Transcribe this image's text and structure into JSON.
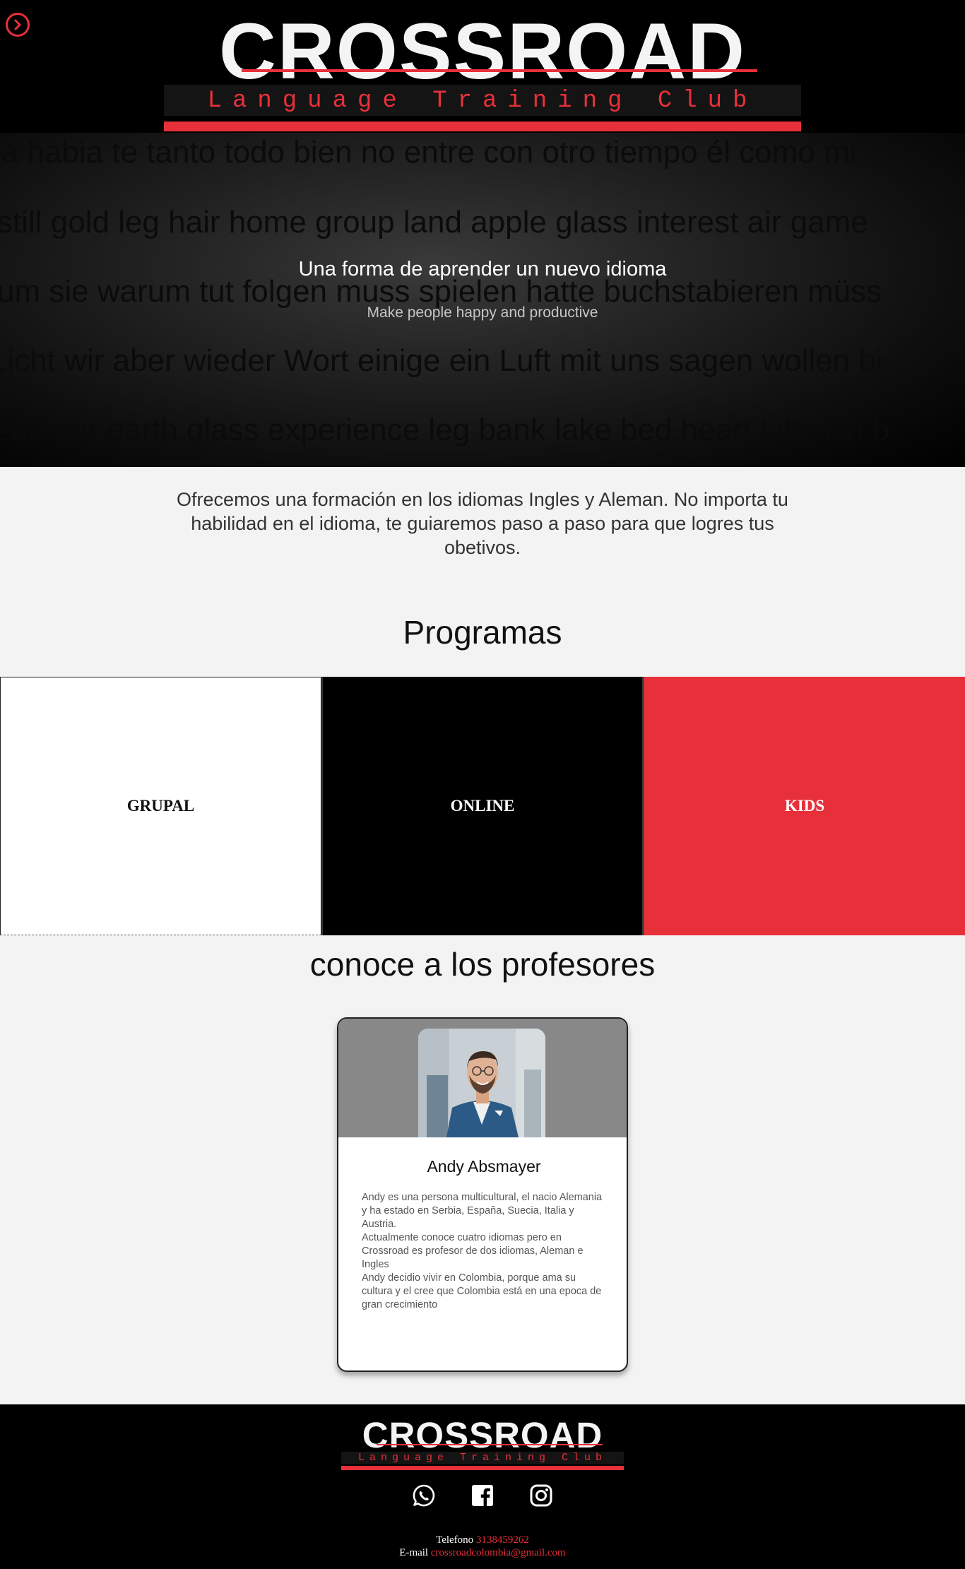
{
  "header": {
    "logo_word": "CROSSROAD",
    "logo_sub": "Language Training Club",
    "menu_icon": "chevron-right-circle-icon",
    "accent_color": "#e8303a"
  },
  "hero": {
    "background_lines": [
      "la habia te tanto todo bien no entre con otro tiempo él como mi",
      "still gold leg hair home group land apple glass interest air game",
      "um sie warum tut folgen muss spielen hatte buchstabieren müss",
      "Licht wir aber wieder Wort einige ein Luft mit uns sagen wollen bi",
      "ed hour earth glass experience leg bank lake bed heart bill inch b"
    ],
    "title": "Una forma de aprender un nuevo idioma",
    "subtitle": "Make people happy and productive"
  },
  "intro": {
    "text": "Ofrecemos una formación en los idiomas Ingles y Aleman. No importa tu habilidad en el idioma, te guiaremos paso a paso para que logres tus obetivos."
  },
  "programs": {
    "title": "Programas",
    "items": [
      {
        "label": "GRUPAL"
      },
      {
        "label": "ONLINE"
      },
      {
        "label": "KIDS"
      }
    ]
  },
  "teachers": {
    "title": "conoce a los profesores",
    "cards": [
      {
        "name": "Andy Absmayer",
        "bio": [
          "Andy es una persona multicultural, el nacio Alemania y ha estado en Serbia, España, Suecia, Italia y Austria.",
          "Actualmente conoce cuatro idiomas pero en Crossroad es profesor de dos idiomas, Aleman e Ingles",
          "Andy decidio vivir en Colombia, porque ama su cultura y el cree que Colombia está en una epoca de gran crecimiento"
        ]
      }
    ]
  },
  "footer": {
    "logo_word": "CROSSROAD",
    "logo_sub": "Language Training Club",
    "social_icons": [
      "whatsapp-icon",
      "facebook-icon",
      "instagram-icon"
    ],
    "phone_label": "Telefono",
    "phone_value": "3138459262",
    "email_label": "E-mail",
    "email_value": "crossroadcolombia@gmail.com"
  }
}
